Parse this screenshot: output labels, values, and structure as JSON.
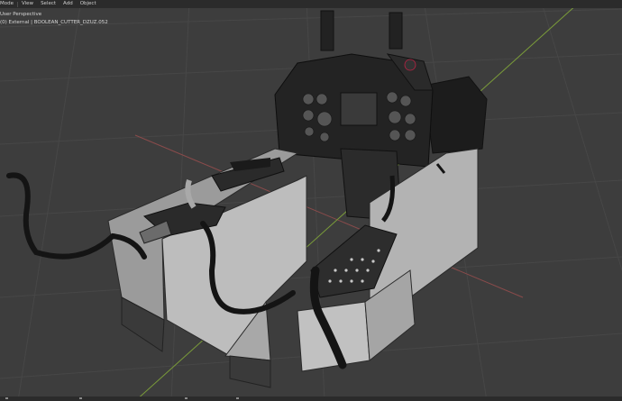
{
  "header": {
    "menus": [
      {
        "label": "Mode"
      },
      {
        "label": "View"
      },
      {
        "label": "Select"
      },
      {
        "label": "Add"
      },
      {
        "label": "Object"
      }
    ]
  },
  "viewport": {
    "overlay_line1": "User Perspective",
    "overlay_line2": "(0) External | BOOLEAN_CUTTER_DZUZ.052",
    "background_color": "#3d3d3d",
    "grid_color": "#474747",
    "x_axis_color": "#8a4b4b",
    "y_axis_color": "#7a9b3a",
    "mesh_light": "#b9b9b9",
    "mesh_dark": "#2a2a2a"
  }
}
